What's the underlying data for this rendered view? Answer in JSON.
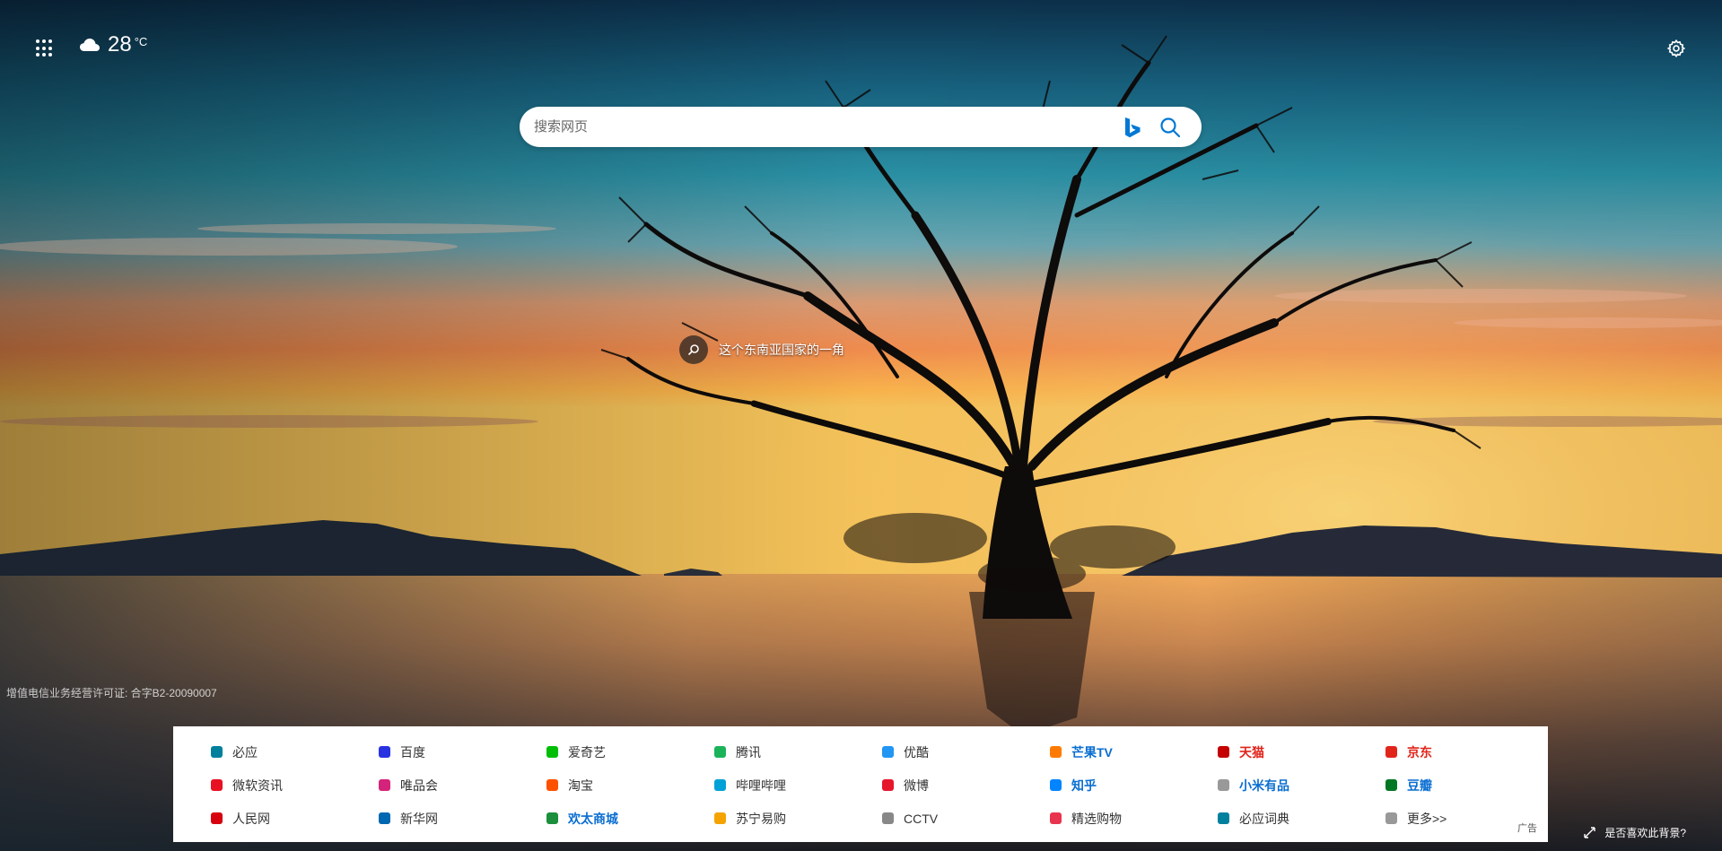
{
  "weather": {
    "temperature": "28",
    "unit": "°C",
    "icon": "cloud-icon"
  },
  "search": {
    "placeholder": "搜索网页",
    "logo": "bing-logo-icon",
    "button_icon": "search-icon"
  },
  "hotspot": {
    "text": "这个东南亚国家的一角"
  },
  "license": "增值电信业务经营许可证: 合字B2-20090007",
  "links": [
    {
      "label": "必应",
      "icon": "bing-icon",
      "color": "#00809d",
      "bold": false,
      "highlight": false
    },
    {
      "label": "百度",
      "icon": "baidu-icon",
      "color": "#2932e1",
      "bold": false,
      "highlight": false
    },
    {
      "label": "爱奇艺",
      "icon": "iqiyi-icon",
      "color": "#00be06",
      "bold": false,
      "highlight": false
    },
    {
      "label": "腾讯",
      "icon": "tencent-icon",
      "color": "#1ab35a",
      "bold": false,
      "highlight": false
    },
    {
      "label": "优酷",
      "icon": "youku-icon",
      "color": "#2196f3",
      "bold": false,
      "highlight": false
    },
    {
      "label": "芒果TV",
      "icon": "mangotv-icon",
      "color": "#ff7a00",
      "bold": true,
      "highlight": "blue"
    },
    {
      "label": "天猫",
      "icon": "tmall-icon",
      "color": "#c40000",
      "bold": true,
      "highlight": "red"
    },
    {
      "label": "京东",
      "icon": "jd-icon",
      "color": "#e1251b",
      "bold": true,
      "highlight": "red"
    },
    {
      "label": "微软资讯",
      "icon": "msn-icon",
      "color": "#e81123",
      "bold": false,
      "highlight": false
    },
    {
      "label": "唯品会",
      "icon": "vip-icon",
      "color": "#d4237a",
      "bold": false,
      "highlight": false
    },
    {
      "label": "淘宝",
      "icon": "taobao-icon",
      "color": "#ff5000",
      "bold": false,
      "highlight": false
    },
    {
      "label": "哔哩哔哩",
      "icon": "bilibili-icon",
      "color": "#00a1d6",
      "bold": false,
      "highlight": false
    },
    {
      "label": "微博",
      "icon": "weibo-icon",
      "color": "#e6162d",
      "bold": false,
      "highlight": false
    },
    {
      "label": "知乎",
      "icon": "zhihu-icon",
      "color": "#0084ff",
      "bold": true,
      "highlight": "blue"
    },
    {
      "label": "小米有品",
      "icon": "xiaomi-youpin-icon",
      "color": "#999999",
      "bold": true,
      "highlight": "blue"
    },
    {
      "label": "豆瓣",
      "icon": "douban-icon",
      "color": "#007722",
      "bold": true,
      "highlight": "blue"
    },
    {
      "label": "人民网",
      "icon": "people-icon",
      "color": "#d7000f",
      "bold": false,
      "highlight": false
    },
    {
      "label": "新华网",
      "icon": "xinhua-icon",
      "color": "#0067b1",
      "bold": false,
      "highlight": false
    },
    {
      "label": "欢太商城",
      "icon": "heytap-icon",
      "color": "#1b8f3c",
      "bold": true,
      "highlight": "blue"
    },
    {
      "label": "苏宁易购",
      "icon": "suning-icon",
      "color": "#f4a300",
      "bold": false,
      "highlight": false
    },
    {
      "label": "CCTV",
      "icon": "cctv-icon",
      "color": "#888888",
      "bold": false,
      "highlight": false
    },
    {
      "label": "精选购物",
      "icon": "shopping-icon",
      "color": "#e8344e",
      "bold": false,
      "highlight": false
    },
    {
      "label": "必应词典",
      "icon": "bing-dict-icon",
      "color": "#00809d",
      "bold": false,
      "highlight": false
    },
    {
      "label": "更多>>",
      "icon": "more-icon",
      "color": "#999999",
      "bold": false,
      "highlight": false
    }
  ],
  "ad_label": "广告",
  "background_feedback": {
    "text": "是否喜欢此背景?",
    "icon": "expand-icon"
  }
}
